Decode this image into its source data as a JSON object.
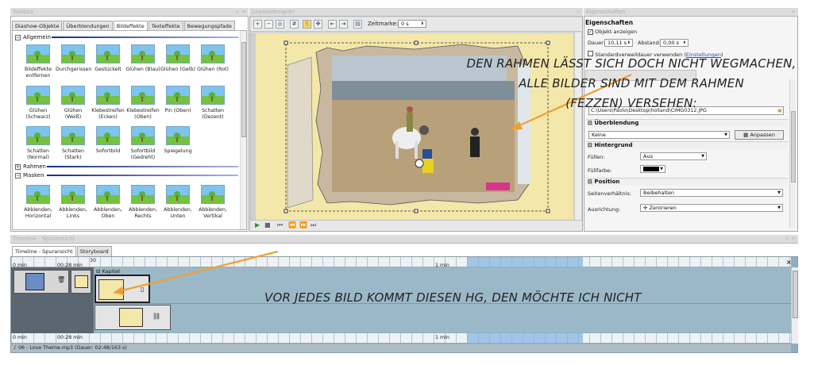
{
  "toolbox": {
    "title": "Toolbox",
    "tabs": [
      "Diashow-Objekte",
      "Überblendungen",
      "Bildeffekte",
      "Texteffekte",
      "Bewegungspfade"
    ],
    "sections": {
      "allgemein": "Allgemein",
      "rahmen": "Rahmen",
      "masken": "Masken"
    },
    "effects_row1": [
      "Bildeffekte entfernen",
      "Durchgerissen",
      "Gestückelt",
      "Glühen (Blau)",
      "Glühen (Gelb)",
      "Glühen (Rot)"
    ],
    "effects_row2": [
      "Glühen (Schwarz)",
      "Glühen (Weiß)",
      "Klebestreifen (Ecken)",
      "Klebestreifen (Oben)",
      "Pin (Oben)",
      "Schatten (Dezent)"
    ],
    "effects_row3": [
      "Schatten (Normal)",
      "Schatten (Stark)",
      "Sofortbild",
      "Sofortbild (Gedreht)",
      "Spiegelung"
    ],
    "mask_row": [
      "Abblenden, Horizontal",
      "Abblenden, Links",
      "Abblenden, Oben",
      "Abblenden, Rechts",
      "Abblenden, Unten",
      "Abblenden, Vertikal"
    ]
  },
  "layout_designer": {
    "title": "Layoutdesigner",
    "zeitmarke_label": "Zeitmarke:",
    "zeitmarke_value": "0 s"
  },
  "properties": {
    "title": "Eigenschaften",
    "heading": "Eigenschaften",
    "show_object": "Objekt anzeigen",
    "duration_label": "Dauer:",
    "duration_value": "10,11 s",
    "distance_label": "Abstand:",
    "distance_value": "0,00 s",
    "standard_label": "Standardverweildauer verwenden (",
    "settings_link": "Einstellungen",
    "standard_suffix": ")",
    "file_path": "C:\\Users\\Paolo\\Desktop\\holland\\CIMG0312.JPG",
    "sec_transition": "Überblendung",
    "transition_value": "Keine",
    "adjust_button": "Anpassen",
    "sec_background": "Hintergrund",
    "fill_label": "Füllen:",
    "fill_value": "Aus",
    "fill_color_label": "Füllfarbe:",
    "sec_position": "Position",
    "aspect_label": "Seitenverhältnis:",
    "aspect_value": "Beibehalten",
    "align_label": "Ausrichtung:",
    "align_value": "Zentrieren"
  },
  "timeline": {
    "title": "Timeline - Spuransicht",
    "tabs": [
      "Timeline - Spuransicht",
      "Storyboard"
    ],
    "time_start": "0 min",
    "time_current": "00:28 min",
    "time_end": "30",
    "minute_label": "1 min",
    "chapter_label": "Kapitel",
    "audio_label": "06 - Love Theme.mp3 (Dauer: 02:48/163 s)"
  },
  "annotations": {
    "frame_note_line1": "DEN RAHMEN LÄSST SICH DOCH NICHT WEGMACHEN,",
    "frame_note_line2": "ALLE BILDER SIND MIT DEM RAHMEN",
    "frame_note_line3": "(FEZZEN) VERSEHEN:",
    "background_note": "VOR JEDES BILD KOMMT DIESEN HG, DEN MÖCHTE ICH NICHT"
  },
  "colors": {
    "canvas_bg": "#f3e7a9",
    "arrow": "#f0a030",
    "timeline_bg": "#9bb8c9",
    "highlight": "#7fb2e0"
  }
}
